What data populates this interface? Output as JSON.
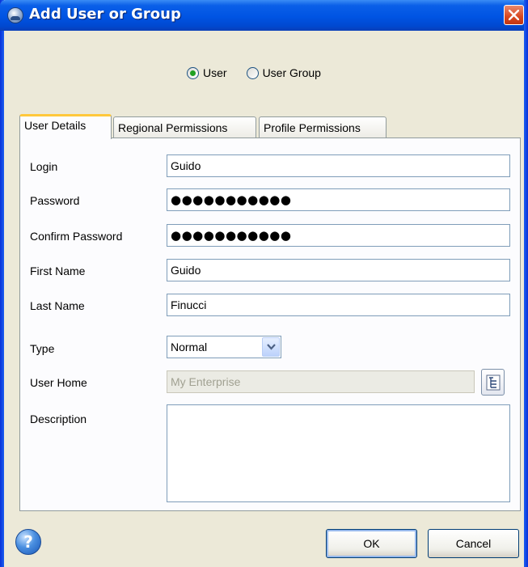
{
  "window": {
    "title": "Add User or Group"
  },
  "mode": {
    "options": [
      {
        "label": "User",
        "checked": true
      },
      {
        "label": "User Group",
        "checked": false
      }
    ]
  },
  "tabs": [
    {
      "label": "User Details",
      "active": true
    },
    {
      "label": "Regional Permissions",
      "active": false
    },
    {
      "label": "Profile Permissions",
      "active": false
    }
  ],
  "form": {
    "login": {
      "label": "Login",
      "value": "Guido"
    },
    "password": {
      "label": "Password",
      "value": "●●●●●●●●●●●"
    },
    "confirm_password": {
      "label": "Confirm Password",
      "value": "●●●●●●●●●●●"
    },
    "first_name": {
      "label": "First Name",
      "value": "Guido"
    },
    "last_name": {
      "label": "Last Name",
      "value": "Finucci"
    },
    "type": {
      "label": "Type",
      "value": "Normal"
    },
    "user_home": {
      "label": "User Home",
      "value": "My Enterprise"
    },
    "description": {
      "label": "Description",
      "value": ""
    }
  },
  "buttons": {
    "help": "?",
    "ok": "OK",
    "cancel": "Cancel"
  }
}
